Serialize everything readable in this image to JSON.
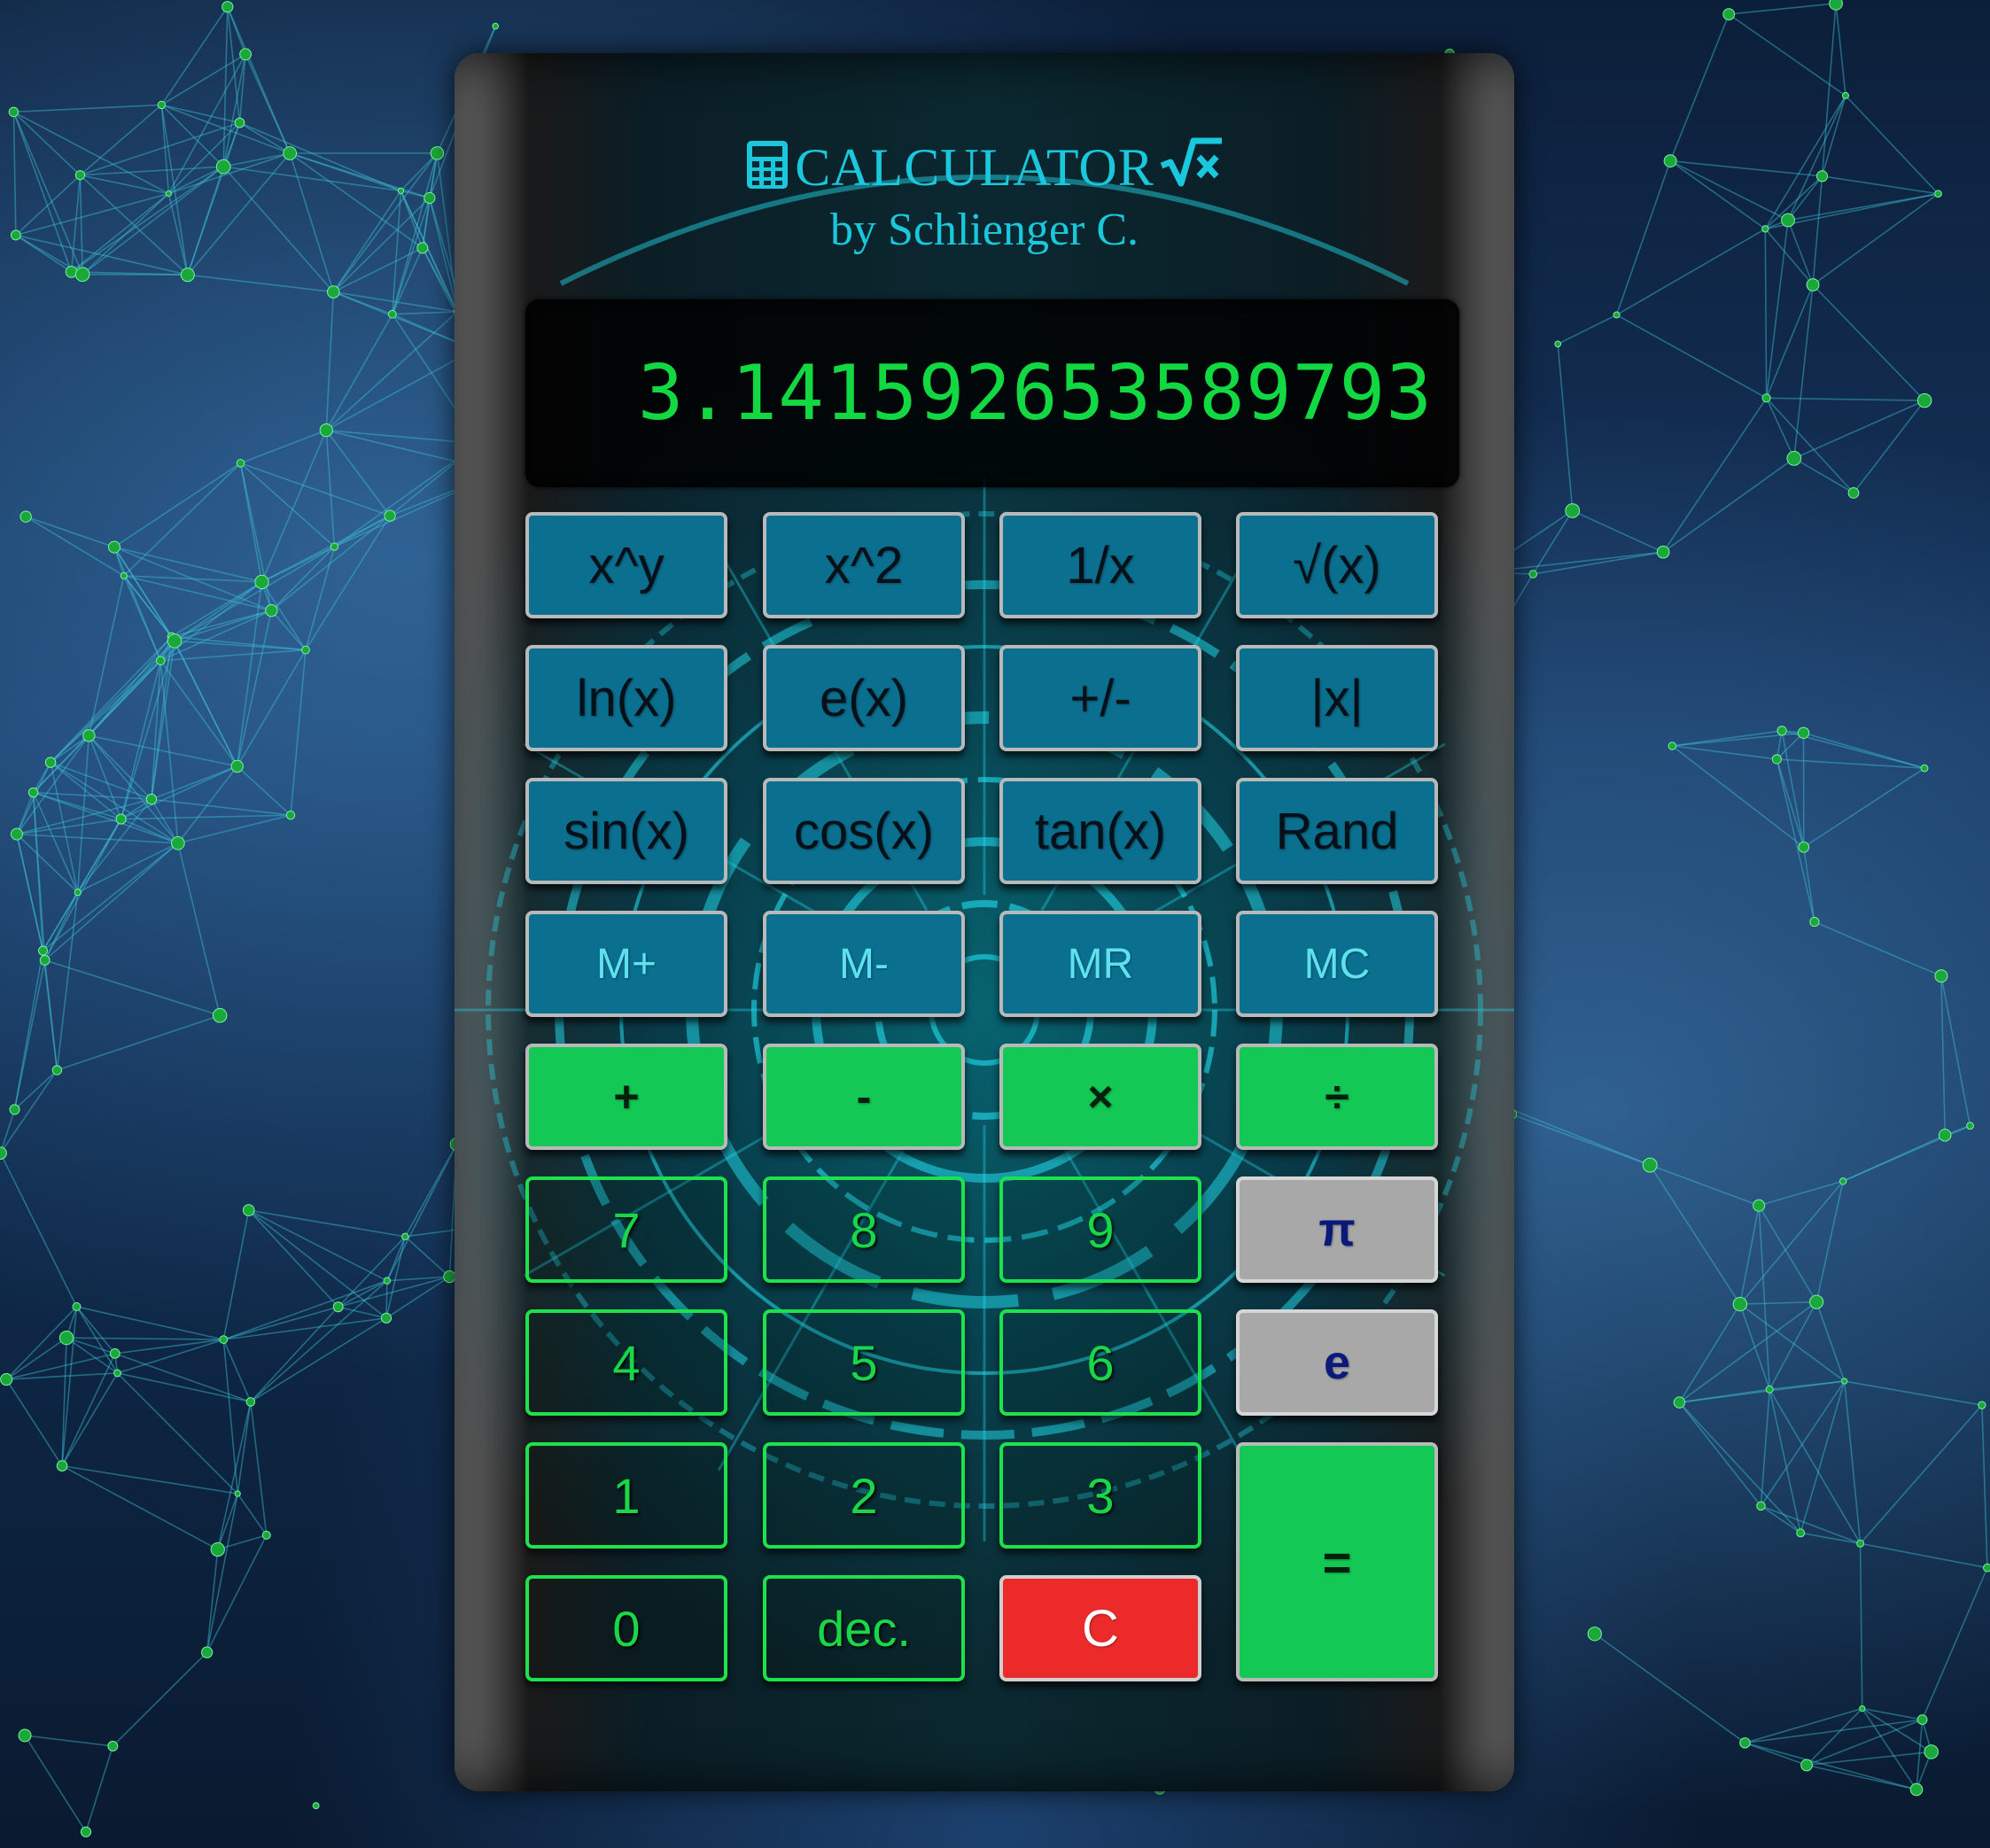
{
  "header": {
    "title": "CALCULATOR",
    "subtitle": "by Schlienger C."
  },
  "display": {
    "value": "3.141592653589793"
  },
  "colors": {
    "accent_cyan": "#19c8dc",
    "display_green": "#12d842",
    "function_key": "#0b6f8f",
    "operator_key": "#13c855",
    "constant_key": "#a8a8a8",
    "clear_key": "#ec2a2a"
  },
  "icons": {
    "title_left": "calculator-icon",
    "title_right": "square-root-icon"
  },
  "keys": {
    "func_row1": [
      "x^y",
      "x^2",
      "1/x",
      "√(x)"
    ],
    "func_row2": [
      "ln(x)",
      "e(x)",
      "+/-",
      "|x|"
    ],
    "func_row3": [
      "sin(x)",
      "cos(x)",
      "tan(x)",
      "Rand"
    ],
    "memory": [
      "M+",
      "M-",
      "MR",
      "MC"
    ],
    "operators": [
      "+",
      "-",
      "×",
      "÷"
    ],
    "digits_row1": [
      "7",
      "8",
      "9"
    ],
    "digits_row2": [
      "4",
      "5",
      "6"
    ],
    "digits_row3": [
      "1",
      "2",
      "3"
    ],
    "zero": "0",
    "decimal": "dec.",
    "clear": "C",
    "pi": "π",
    "e": "e",
    "equals": "="
  }
}
